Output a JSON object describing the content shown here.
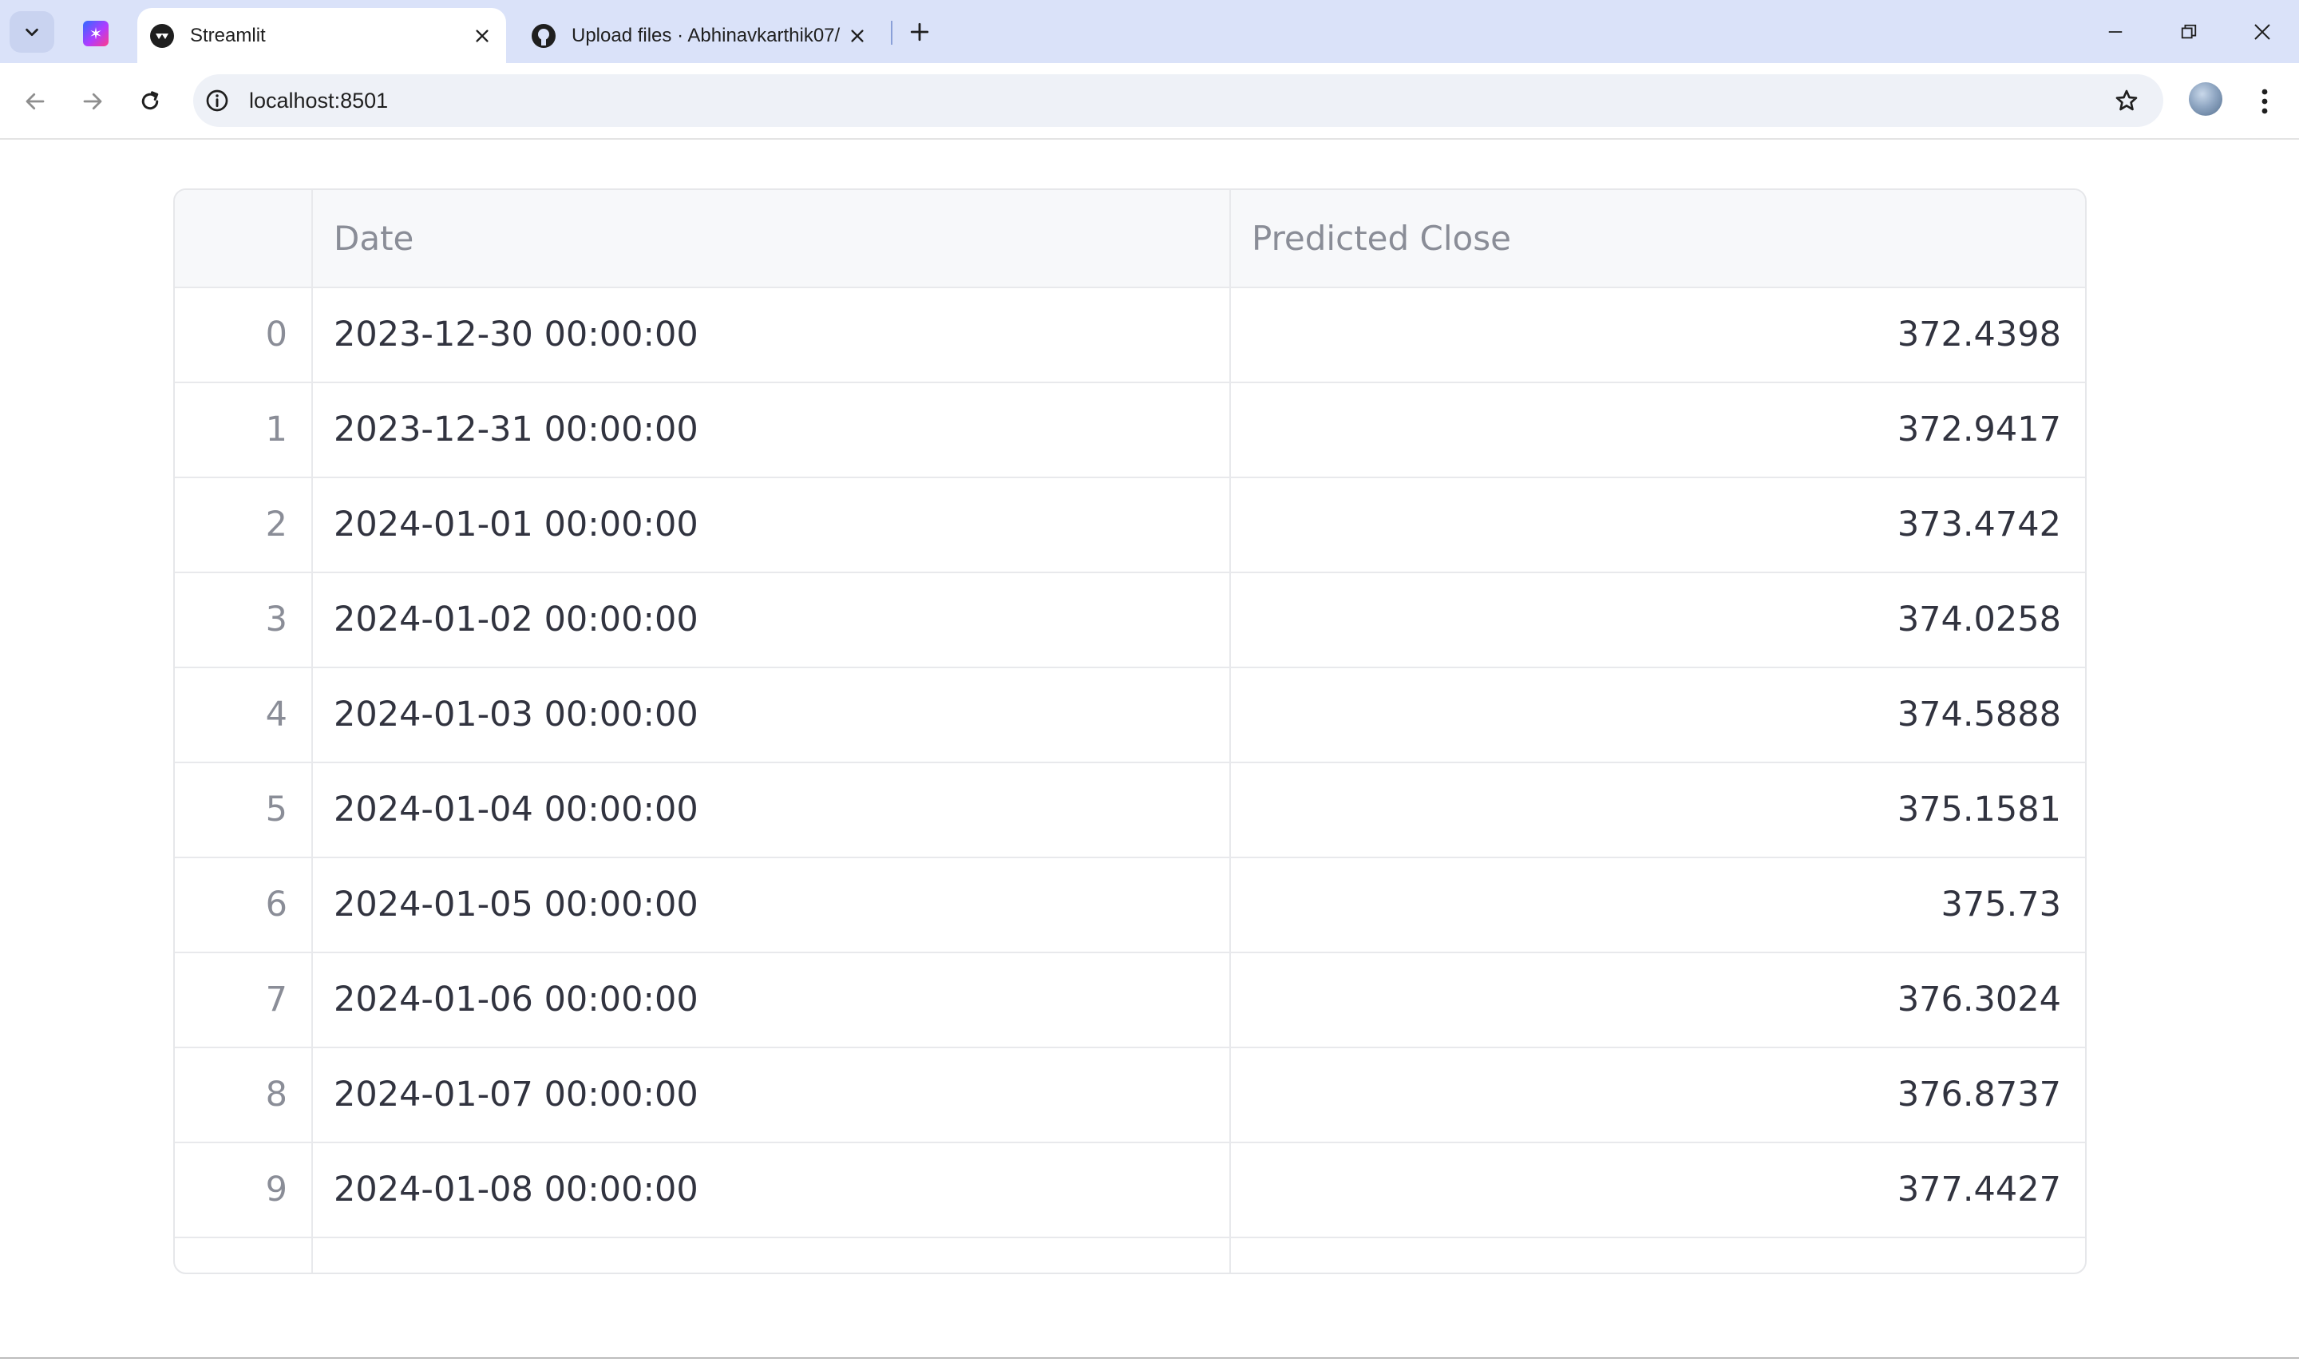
{
  "browser": {
    "tabs": [
      {
        "title": "Streamlit",
        "favicon": "streamlit-icon",
        "active": true
      },
      {
        "title": "Upload files · Abhinavkarthik07/",
        "favicon": "github-icon",
        "active": false
      }
    ],
    "url": "localhost:8501"
  },
  "dataframe": {
    "columns": [
      "",
      "Date",
      "Predicted Close"
    ],
    "rows": [
      {
        "index": "0",
        "date": "2023-12-30 00:00:00",
        "predicted_close": "372.4398"
      },
      {
        "index": "1",
        "date": "2023-12-31 00:00:00",
        "predicted_close": "372.9417"
      },
      {
        "index": "2",
        "date": "2024-01-01 00:00:00",
        "predicted_close": "373.4742"
      },
      {
        "index": "3",
        "date": "2024-01-02 00:00:00",
        "predicted_close": "374.0258"
      },
      {
        "index": "4",
        "date": "2024-01-03 00:00:00",
        "predicted_close": "374.5888"
      },
      {
        "index": "5",
        "date": "2024-01-04 00:00:00",
        "predicted_close": "375.1581"
      },
      {
        "index": "6",
        "date": "2024-01-05 00:00:00",
        "predicted_close": "375.73"
      },
      {
        "index": "7",
        "date": "2024-01-06 00:00:00",
        "predicted_close": "376.3024"
      },
      {
        "index": "8",
        "date": "2024-01-07 00:00:00",
        "predicted_close": "376.8737"
      },
      {
        "index": "9",
        "date": "2024-01-08 00:00:00",
        "predicted_close": "377.4427"
      }
    ]
  }
}
